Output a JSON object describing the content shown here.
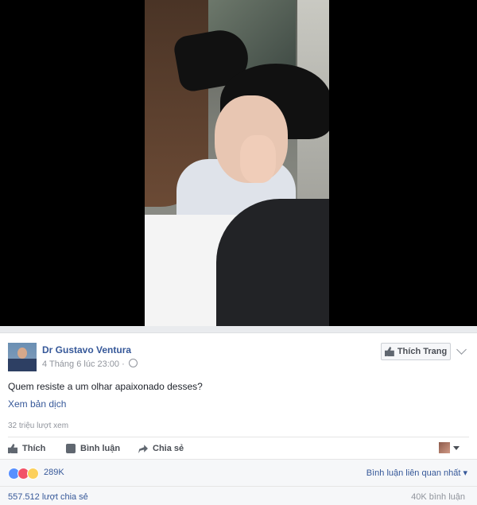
{
  "post": {
    "author": "Dr Gustavo Ventura",
    "timestamp": "4 Tháng 6 lúc 23:00",
    "text": "Quem resiste a um olhar apaixonado desses?",
    "translate_link": "Xem bản dịch",
    "view_count": "32 triệu lượt xem",
    "like_page_label": "Thích Trang"
  },
  "actions": {
    "like": "Thích",
    "comment": "Bình luận",
    "share": "Chia sẻ"
  },
  "stats": {
    "reaction_count": "289K",
    "comment_sort": "Bình luận liên quan nhất",
    "shares": "557.512 lượt chia sẻ",
    "comments": "40K bình luận"
  },
  "colors": {
    "link": "#365899",
    "like": "#5890ff",
    "love": "#f25268",
    "haha": "#fcd05c"
  },
  "icons": {
    "like": "thumb-up-icon",
    "comment": "comment-bubble-icon",
    "share": "share-arrow-icon",
    "globe": "globe-icon"
  }
}
